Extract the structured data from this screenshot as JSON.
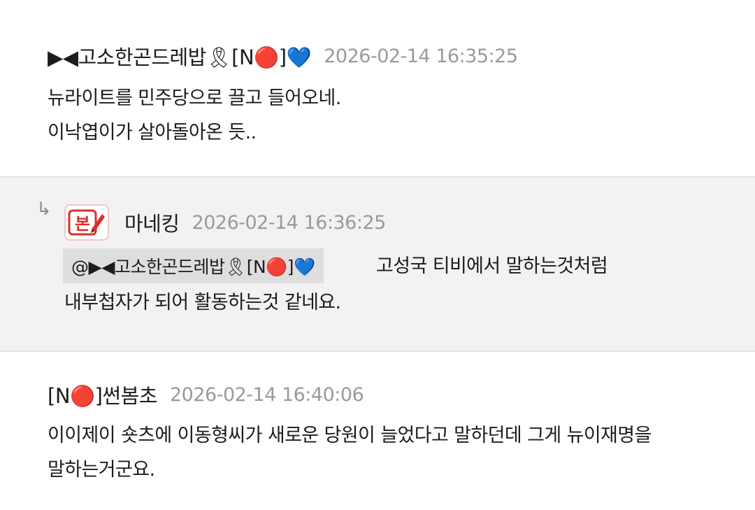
{
  "comments": [
    {
      "nickname": "▶◀고소한곤드레밥🎗[N🔴]💙",
      "timestamp": "2026-02-14 16:35:25",
      "lines": [
        "뉴라이트를 민주당으로 끌고 들어오네.",
        "이낙엽이가 살아돌아온 듯.."
      ]
    },
    {
      "nickname": "마네킹",
      "timestamp": "2026-02-14 16:36:25",
      "avatar_icon": "bon-badge-icon",
      "avatar_text": "본",
      "reply_marker": "↳",
      "mention": "@▶◀고소한곤드레밥🎗[N🔴]💙",
      "lines": [
        "고성국 티비에서 말하는것처럼",
        "내부첩자가 되어 활동하는것 같네요."
      ]
    },
    {
      "nickname": "[N🔴]썬봄초",
      "timestamp": "2026-02-14 16:40:06",
      "lines": [
        "이이제이 숏츠에 이동형씨가 새로운 당원이 늘었다고 말하던데 그게 뉴이재명을",
        "말하는거군요."
      ]
    }
  ],
  "colors": {
    "reply_background": "#f2f2f2",
    "mention_background": "#dedede",
    "timestamp": "#9a9a9a",
    "divider": "#e2e2e2",
    "avatar_red": "#d9302c"
  }
}
